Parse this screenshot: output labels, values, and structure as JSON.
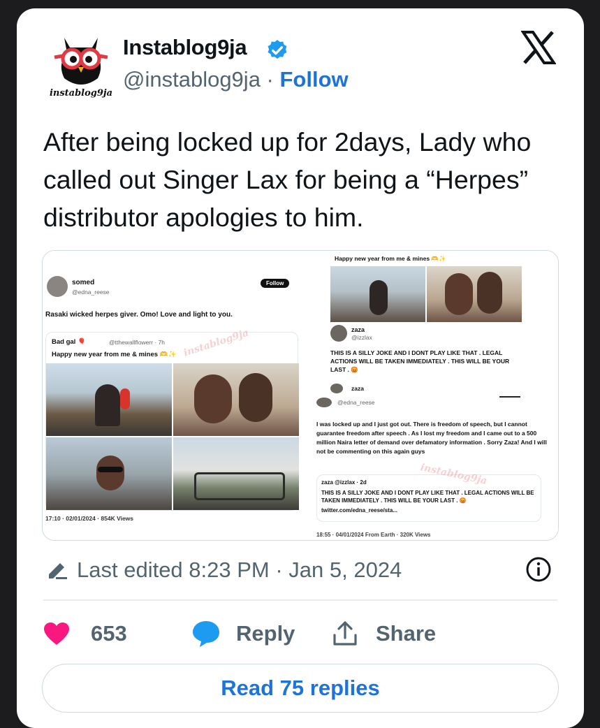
{
  "header": {
    "name": "Instablog9ja",
    "handle": "@instablog9ja",
    "separator": " · ",
    "follow_label": "Follow",
    "avatar_word": "instablog9ja",
    "verified_color": "#1d9bf0"
  },
  "tweet": {
    "text": "After being locked up for 2days, Lady who called out Singer Lax for being a “Herpes” distributor apologies to him."
  },
  "media": {
    "left": {
      "user_name": "somed",
      "user_handle": "@edna_reese",
      "follow_label": "Follow",
      "post_text": "Rasaki wicked herpes giver. Omo! Love and light to you.",
      "quoted_name": "Bad gal 🎈",
      "quoted_handle": "@tthewallflowerr · 7h",
      "quoted_text": "Happy new year from me & mines 🫶✨",
      "timestamp": "17:10 · 02/01/2024 · 854K Views",
      "watermark": "instablog9ja"
    },
    "right": {
      "top_text": "Happy new year from me & mines 🫶✨",
      "reply_name": "zaza",
      "reply_handle": "@izzlax",
      "reply_text": "THIS IS A SILLY JOKE AND I DONT PLAY LIKE THAT . LEGAL ACTIONS WILL BE TAKEN IMMEDIATELY . THIS WILL BE YOUR LAST . 😡",
      "reply2_name": "zaza",
      "apology_handle": "@edna_reese",
      "apology_text": "I was locked up and I just got out. There is freedom of speech, but I cannot guarantee freedom after speech . As I lost my freedom and I came out to a 500 million Naira letter of demand over defamatory information . Sorry Zaza! And I will not be commenting on this again guys",
      "quote_header": "zaza @izzlax · 2d",
      "quote_text": "THIS IS A SILLY JOKE AND I DONT PLAY LIKE THAT . LEGAL ACTIONS WILL BE TAKEN IMMEDIATELY . THIS WILL BE YOUR LAST . 😡",
      "quote_link": "twitter.com/edna_reese/sta...",
      "timestamp": "18:55 · 04/01/2024 From Earth · 320K Views",
      "watermark": "instablog9ja"
    }
  },
  "footer": {
    "edited_text": "Last edited 8:23 PM · Jan 5, 2024",
    "likes_count": "653",
    "reply_label": "Reply",
    "share_label": "Share",
    "read_replies_label": "Read 75 replies",
    "like_color": "#f91880",
    "reply_color": "#1d9bf0"
  },
  "icons": [
    "owl-avatar-icon",
    "verified-badge-icon",
    "x-logo-icon",
    "pencil-icon",
    "info-icon",
    "heart-icon",
    "reply-bubble-icon",
    "share-icon"
  ]
}
